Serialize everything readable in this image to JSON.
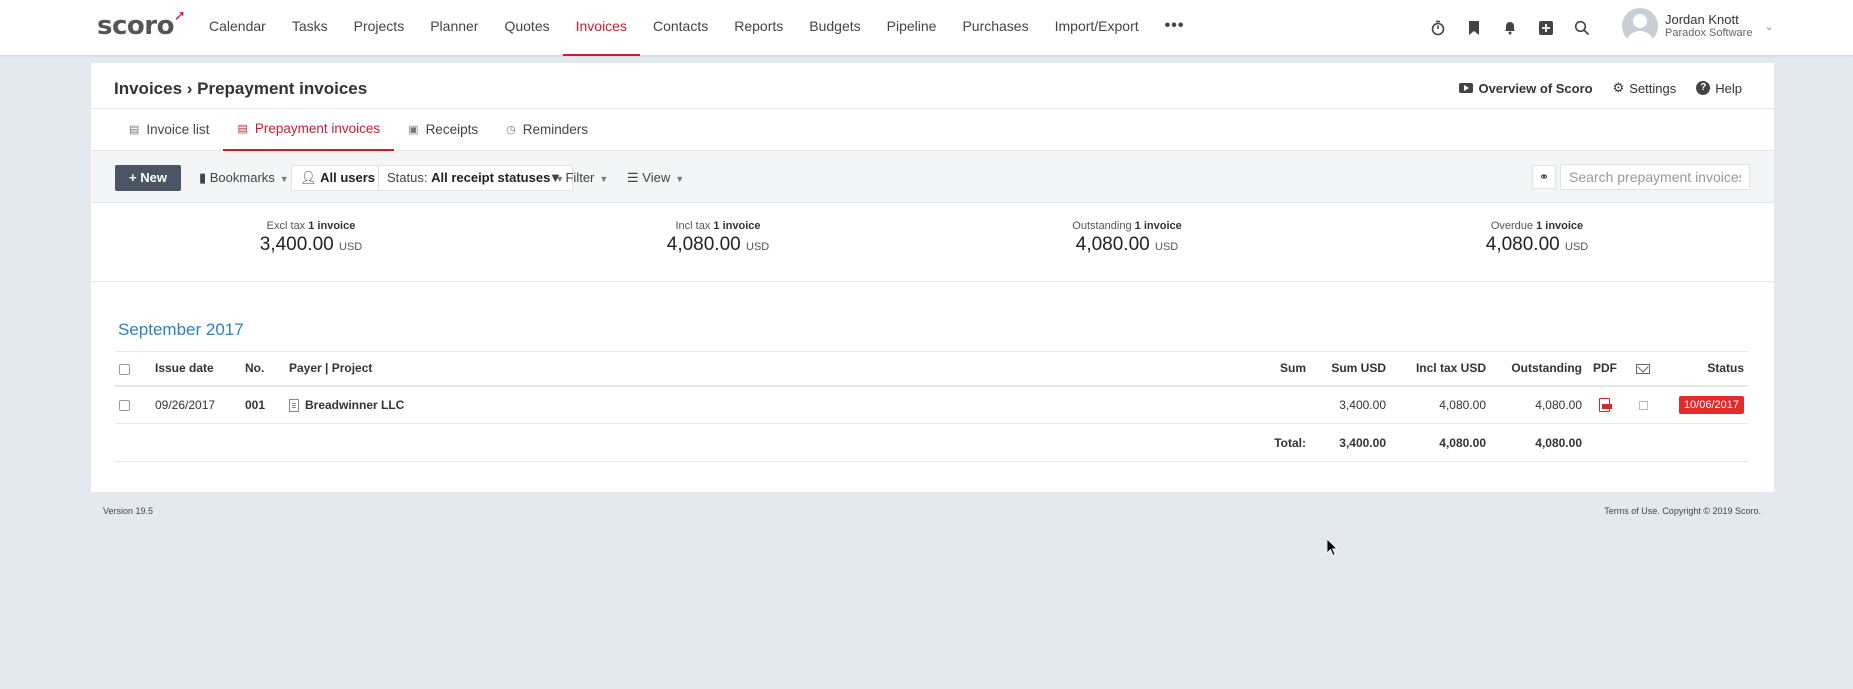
{
  "app": {
    "logo": "scoro"
  },
  "nav": {
    "items": [
      "Calendar",
      "Tasks",
      "Projects",
      "Planner",
      "Quotes",
      "Invoices",
      "Contacts",
      "Reports",
      "Budgets",
      "Pipeline",
      "Purchases",
      "Import/Export"
    ],
    "active": "Invoices",
    "more": "•••"
  },
  "user": {
    "name": "Jordan Knott",
    "company": "Paradox Software"
  },
  "page": {
    "breadcrumb": "Invoices › Prepayment invoices",
    "links": {
      "overview": "Overview of Scoro",
      "settings": "Settings",
      "help": "Help"
    }
  },
  "tabs": [
    {
      "label": "Invoice list",
      "icon": "list-icon"
    },
    {
      "label": "Prepayment invoices",
      "icon": "prepayment-icon",
      "active": true
    },
    {
      "label": "Receipts",
      "icon": "receipt-icon"
    },
    {
      "label": "Reminders",
      "icon": "clock-icon"
    }
  ],
  "toolbar": {
    "new_label": "New",
    "bookmarks_label": "Bookmarks",
    "users_label": "All users",
    "status_prefix": "Status:",
    "status_value": "All receipt statuses",
    "filter_label": "Filter",
    "view_label": "View",
    "search_placeholder": "Search prepayment invoices"
  },
  "summary": [
    {
      "label": "Excl tax",
      "count": "1 invoice",
      "value": "3,400.00",
      "currency": "USD"
    },
    {
      "label": "Incl tax",
      "count": "1 invoice",
      "value": "4,080.00",
      "currency": "USD"
    },
    {
      "label": "Outstanding",
      "count": "1 invoice",
      "value": "4,080.00",
      "currency": "USD"
    },
    {
      "label": "Overdue",
      "count": "1 invoice",
      "value": "4,080.00",
      "currency": "USD"
    }
  ],
  "group": {
    "month": "September 2017"
  },
  "table": {
    "headers": {
      "issue_date": "Issue date",
      "no": "No.",
      "payer": "Payer | Project",
      "sum": "Sum",
      "sum_usd": "Sum USD",
      "incl_tax": "Incl tax USD",
      "outstanding": "Outstanding",
      "pdf": "PDF",
      "status": "Status"
    },
    "rows": [
      {
        "issue_date": "09/26/2017",
        "no": "001",
        "payer": "Breadwinner LLC",
        "sum": "",
        "sum_usd": "3,400.00",
        "incl_tax": "4,080.00",
        "outstanding": "4,080.00",
        "status": "10/06/2017"
      }
    ],
    "total": {
      "label": "Total:",
      "sum_usd": "3,400.00",
      "incl_tax": "4,080.00",
      "outstanding": "4,080.00"
    }
  },
  "footer": {
    "version": "Version 19.5",
    "copyright": "Terms of Use. Copyright © 2019 Scoro."
  },
  "colors": {
    "accent": "#c8202d",
    "link": "#2f80c0",
    "status_overdue": "#e32b2b",
    "background": "#e4e8ef"
  }
}
